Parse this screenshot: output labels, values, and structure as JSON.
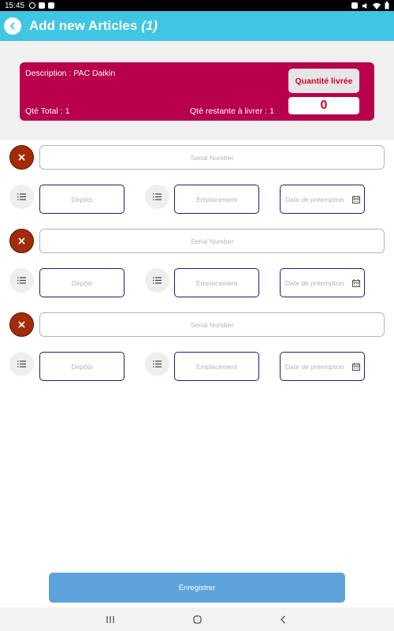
{
  "status_bar": {
    "time": "15:45",
    "left_icons": [
      "app-icon",
      "youtube-icon",
      "image-icon"
    ],
    "right_icons": [
      "alarm-icon",
      "mute-icon",
      "wifi-icon",
      "battery-icon"
    ]
  },
  "app_bar": {
    "back_icon": "chevron-left-icon",
    "title": "Add new Articles",
    "count": "(1)"
  },
  "summary": {
    "description": "Description : PAC Daikin",
    "total": "Qté Total : 1",
    "remaining": "Qté restante à livrer : 1",
    "delivered_button": "Quantité livrée",
    "delivered_value": "0"
  },
  "articles": [
    {
      "serial_placeholder": "Serial Number",
      "depot_placeholder": "Dépôts",
      "location_placeholder": "Emplacement",
      "date_placeholder": "Date de préemption"
    },
    {
      "serial_placeholder": "Serial Number",
      "depot_placeholder": "Dépôts",
      "location_placeholder": "Emplacement",
      "date_placeholder": "Date de préemption"
    },
    {
      "serial_placeholder": "Serial Number",
      "depot_placeholder": "Dépôts",
      "location_placeholder": "Emplacement",
      "date_placeholder": "Date de préemption"
    }
  ],
  "save_button": "Enregistrer",
  "nav_bar": {
    "icons": [
      "recent-apps-icon",
      "home-icon",
      "back-icon"
    ]
  },
  "colors": {
    "app_bar": "#40c5e3",
    "card": "#b8004c",
    "quantity_text": "#d2002a",
    "remove_button": "#a52b08",
    "field_border": "#1a1a8c",
    "save_button": "#5fa3dd"
  }
}
